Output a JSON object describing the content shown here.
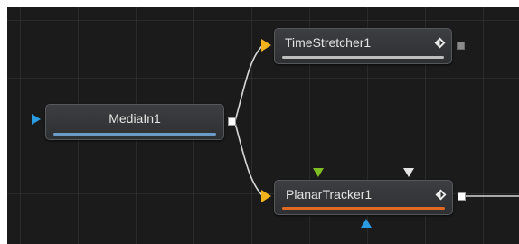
{
  "colors": {
    "canvas_bg": "#1b1b1c",
    "node_bg": "#36373a",
    "node_border": "#57585c",
    "wire": "#d8d8d8",
    "input_yellow": "#f2b21b",
    "input_blue": "#2b9be2",
    "mask_green": "#7fbd25",
    "mask_white": "#e4e4e4",
    "bar_mediain": "#6d9bc9",
    "bar_timestretcher": "#bdbdbd",
    "bar_planartracker": "#e06a21"
  },
  "nodes": {
    "mediain": {
      "label": "MediaIn1"
    },
    "timestretcher": {
      "label": "TimeStretcher1"
    },
    "planartracker": {
      "label": "PlanarTracker1"
    }
  }
}
